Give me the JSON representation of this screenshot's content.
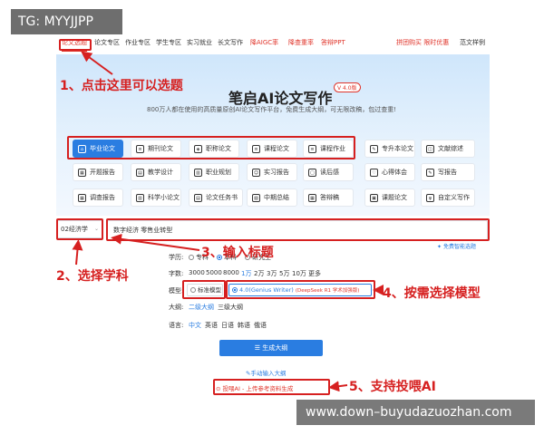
{
  "watermark": {
    "top": "TG: MYYJJPP",
    "bottom": "www.down–buyudazuozhan.com"
  },
  "nav": {
    "items": [
      "论文选题",
      "论文专区",
      "作业专区",
      "学生专区",
      "实习就业",
      "长文写作",
      "降AIGC率",
      "降查重率",
      "答辩PPT"
    ],
    "right_red": "拼团购买 限时优惠",
    "right": "范文样例"
  },
  "hero": {
    "title": "笔启AI论文写作",
    "version": "V 4.0版",
    "subtitle": "800万人都在使用的高质量原创AI论文写作平台，免费生成大纲，可无限改稿，包过查重!"
  },
  "categories": {
    "row1": [
      "毕业论文",
      "期刊论文",
      "职称论文",
      "课程论文",
      "课程作业",
      "专升本论文",
      "文献综述"
    ],
    "row2": [
      "开题报告",
      "教学设计",
      "职业规划",
      "实习报告",
      "读后感",
      "心得体会",
      "写报告"
    ],
    "row3": [
      "调查报告",
      "科学小论文",
      "论文任务书",
      "中期总结",
      "答辩稿",
      "课题论文",
      "自定义写作"
    ]
  },
  "form": {
    "subject_value": "02经济学",
    "title_value": "数字经济 零售业转型",
    "free_link": "免费智能选题",
    "edu_label": "学历:",
    "edu_options": [
      "专科",
      "本科",
      "研究生"
    ],
    "words_label": "字数:",
    "words_options": [
      "3000",
      "5000",
      "8000",
      "1万",
      "2万",
      "3万",
      "5万",
      "10万",
      "更多"
    ],
    "model_label": "模型:",
    "model_standard": "标准模型",
    "model_genius": "4.0(Genius Writer)",
    "model_deepseek": "(DeepSeek R1 学术加强版)",
    "outline_label": "大纲:",
    "outline_options": [
      "二级大纲",
      "三级大纲"
    ],
    "lang_label": "语言:",
    "lang_options": [
      "中文",
      "英语",
      "日语",
      "韩语",
      "俄语"
    ],
    "generate_button": "生成大纲",
    "manual_link": "手动输入大纲",
    "ai_feed": "投喂AI - 上传参考资料生成"
  },
  "annotations": {
    "a1": "1、点击这里可以选题",
    "a2": "2、选择学科",
    "a3": "3、输入标题",
    "a4": "4、按需选择模型",
    "a5": "5、支持投喂AI"
  },
  "colors": {
    "accent": "#2a7de1",
    "annotation_red": "#d62020",
    "hero_bg": "#d8ebfc"
  }
}
